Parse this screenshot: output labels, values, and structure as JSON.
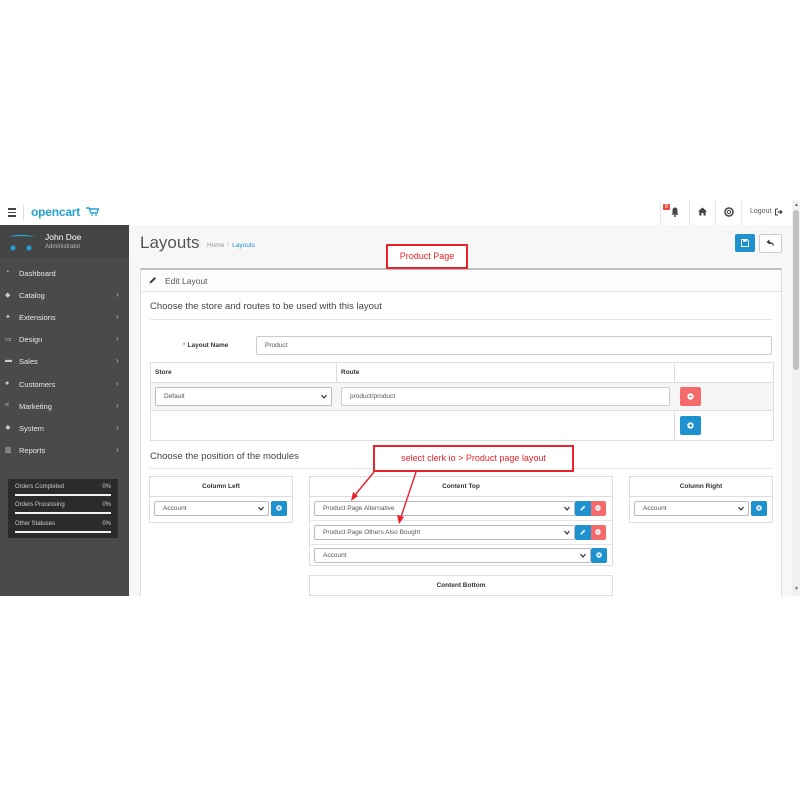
{
  "header": {
    "brand": "opencart",
    "notification_count": "8",
    "logout_label": "Logout"
  },
  "sidebar": {
    "user_name": "John Doe",
    "user_role": "Administrator",
    "items": [
      {
        "label": "Dashboard",
        "icon": "dashboard-icon",
        "has_children": false
      },
      {
        "label": "Catalog",
        "icon": "tag-icon",
        "has_children": true
      },
      {
        "label": "Extensions",
        "icon": "puzzle-icon",
        "has_children": true
      },
      {
        "label": "Design",
        "icon": "monitor-icon",
        "has_children": true
      },
      {
        "label": "Sales",
        "icon": "cart-icon",
        "has_children": true
      },
      {
        "label": "Customers",
        "icon": "user-icon",
        "has_children": true
      },
      {
        "label": "Marketing",
        "icon": "share-icon",
        "has_children": true
      },
      {
        "label": "System",
        "icon": "gear-icon",
        "has_children": true
      },
      {
        "label": "Reports",
        "icon": "bar-chart-icon",
        "has_children": true
      }
    ],
    "stats": [
      {
        "label": "Orders Completed",
        "value": "0%"
      },
      {
        "label": "Orders Processing",
        "value": "0%"
      },
      {
        "label": "Other Statuses",
        "value": "0%"
      }
    ]
  },
  "page": {
    "title": "Layouts",
    "breadcrumb": [
      "Home",
      "Layouts"
    ]
  },
  "panel": {
    "title": "Edit Layout",
    "legend_routes": "Choose the store and routes to be used with this layout",
    "layout_name_label": "Layout Name",
    "layout_name_value": "Product",
    "table_headers": [
      "Store",
      "Route"
    ],
    "store_value": "Default",
    "route_value": "product/product",
    "legend_modules": "Choose the position of the modules",
    "column_left": {
      "title": "Column Left",
      "selected": "Account"
    },
    "content_top": {
      "title": "Content Top",
      "modules": [
        "Product Page Alternative",
        "Product Page Others Also Bought"
      ],
      "add_selected": "Account"
    },
    "column_right": {
      "title": "Column Right",
      "selected": "Account"
    },
    "content_bottom": {
      "title": "Content Bottom"
    }
  },
  "annotations": {
    "product_page": "Product Page",
    "select_hint": "select clerk io > Product page layout"
  },
  "colors": {
    "primary": "#1e91cf",
    "danger": "#f56b6b",
    "sidebar": "#4a4a4a",
    "annotation": "#e8242a"
  }
}
